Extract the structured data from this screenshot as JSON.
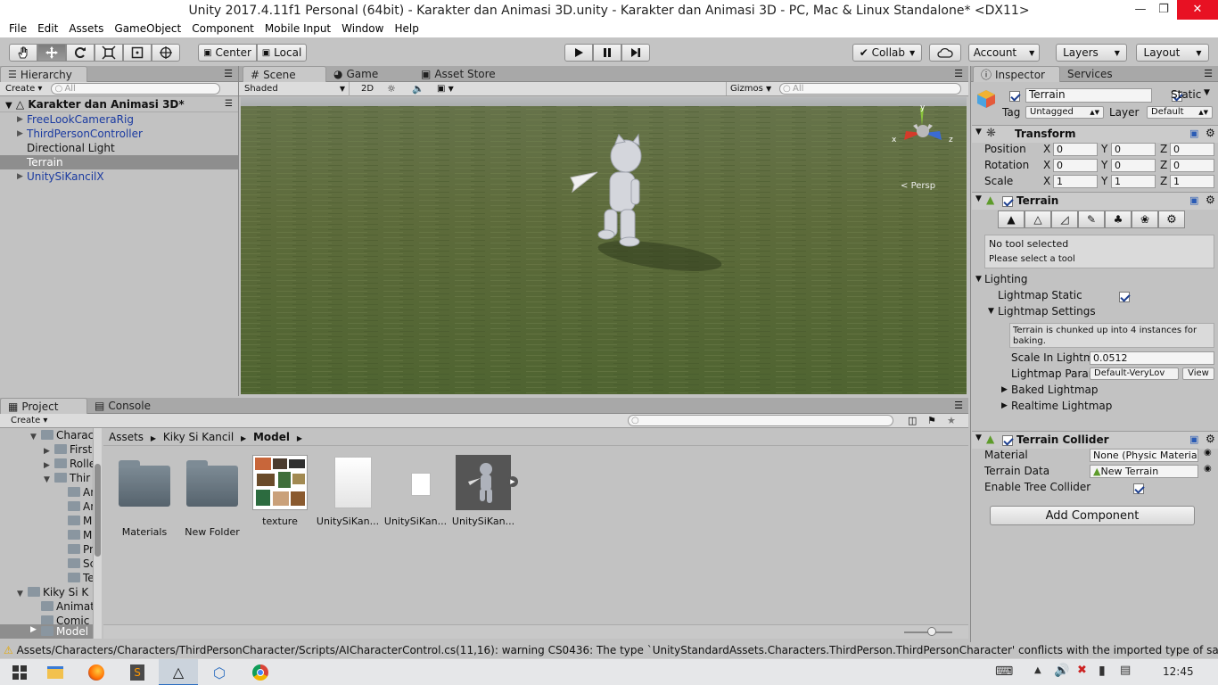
{
  "window": {
    "title": "Unity 2017.4.11f1 Personal (64bit) - Karakter dan Animasi 3D.unity - Karakter dan Animasi 3D - PC, Mac & Linux Standalone* <DX11>"
  },
  "menu": [
    "File",
    "Edit",
    "Assets",
    "GameObject",
    "Component",
    "Mobile Input",
    "Window",
    "Help"
  ],
  "toolbar": {
    "center": "Center",
    "local": "Local",
    "collab": "Collab",
    "account": "Account",
    "layers": "Layers",
    "layout": "Layout"
  },
  "hierarchy": {
    "tab": "Hierarchy",
    "create": "Create",
    "search_placeholder": "All",
    "scene": "Karakter dan Animasi 3D*",
    "items": [
      {
        "label": "FreeLookCameraRig"
      },
      {
        "label": "ThirdPersonController"
      },
      {
        "label": "Directional Light"
      },
      {
        "label": "Terrain"
      },
      {
        "label": "UnitySiKancilX"
      }
    ]
  },
  "scene_view": {
    "tabs": {
      "scene": "Scene",
      "game": "Game",
      "asset_store": "Asset Store"
    },
    "shading": "Shaded",
    "mode_2d": "2D",
    "gizmos": "Gizmos",
    "search_placeholder": "All",
    "gizmo": {
      "x": "x",
      "y": "y",
      "z": "z",
      "persp": "Persp"
    }
  },
  "inspector": {
    "tabs": {
      "inspector": "Inspector",
      "services": "Services"
    },
    "object_name": "Terrain",
    "static": "Static",
    "tag_label": "Tag",
    "tag": "Untagged",
    "layer_label": "Layer",
    "layer": "Default",
    "transform": {
      "title": "Transform",
      "position": {
        "label": "Position",
        "x": "0",
        "y": "0",
        "z": "0"
      },
      "rotation": {
        "label": "Rotation",
        "x": "0",
        "y": "0",
        "z": "0"
      },
      "scale": {
        "label": "Scale",
        "x": "1",
        "y": "1",
        "z": "1"
      }
    },
    "axis": {
      "x": "X",
      "y": "Y",
      "z": "Z"
    },
    "terrain": {
      "title": "Terrain",
      "no_tool": "No tool selected",
      "please_select": "Please select a tool",
      "lighting": "Lighting",
      "lightmap_static": "Lightmap Static",
      "lightmap_settings": "Lightmap Settings",
      "info": "Terrain is chunked up into 4 instances for baking.",
      "scale_label": "Scale In Lightm",
      "scale_value": "0.0512",
      "param_label": "Lightmap Parar",
      "param_value": "Default-VeryLov",
      "view": "View",
      "baked": "Baked Lightmap",
      "realtime": "Realtime Lightmap"
    },
    "collider": {
      "title": "Terrain Collider",
      "material_label": "Material",
      "material_value": "None (Physic Materia",
      "data_label": "Terrain Data",
      "data_value": "New Terrain",
      "tree_label": "Enable Tree Collider"
    },
    "add_component": "Add Component"
  },
  "project": {
    "tabs": {
      "project": "Project",
      "console": "Console"
    },
    "create": "Create",
    "breadcrumb": [
      "Assets",
      "Kiky Si Kancil",
      "Model"
    ],
    "tree": [
      {
        "label": "Charac",
        "indent": 2,
        "open": true
      },
      {
        "label": "First",
        "indent": 3,
        "open": false
      },
      {
        "label": "Rolle",
        "indent": 3,
        "open": false
      },
      {
        "label": "Thir",
        "indent": 3,
        "open": true
      },
      {
        "label": "An",
        "indent": 4
      },
      {
        "label": "An",
        "indent": 4
      },
      {
        "label": "M",
        "indent": 4
      },
      {
        "label": "M",
        "indent": 4
      },
      {
        "label": "Pr",
        "indent": 4
      },
      {
        "label": "Sc",
        "indent": 4
      },
      {
        "label": "Te",
        "indent": 4
      },
      {
        "label": "Kiky Si K",
        "indent": 1,
        "open": true
      },
      {
        "label": "Animat",
        "indent": 2
      },
      {
        "label": "Comic",
        "indent": 2
      },
      {
        "label": "Model",
        "indent": 2,
        "open": false,
        "selected": true
      }
    ],
    "assets": [
      {
        "label": "Materials",
        "kind": "folder"
      },
      {
        "label": "New Folder",
        "kind": "folder"
      },
      {
        "label": "texture",
        "kind": "texture"
      },
      {
        "label": "UnitySiKan...",
        "kind": "file"
      },
      {
        "label": "UnitySiKan...",
        "kind": "small-file"
      },
      {
        "label": "UnitySiKan...",
        "kind": "model"
      }
    ]
  },
  "status": {
    "message": "Assets/Characters/Characters/ThirdPersonCharacter/Scripts/AICharacterControl.cs(11,16): warning CS0436: The type `UnityStandardAssets.Characters.ThirdPerson.ThirdPersonCharacter' conflicts with the imported type of same nam"
  },
  "taskbar": {
    "time": "12:45"
  }
}
